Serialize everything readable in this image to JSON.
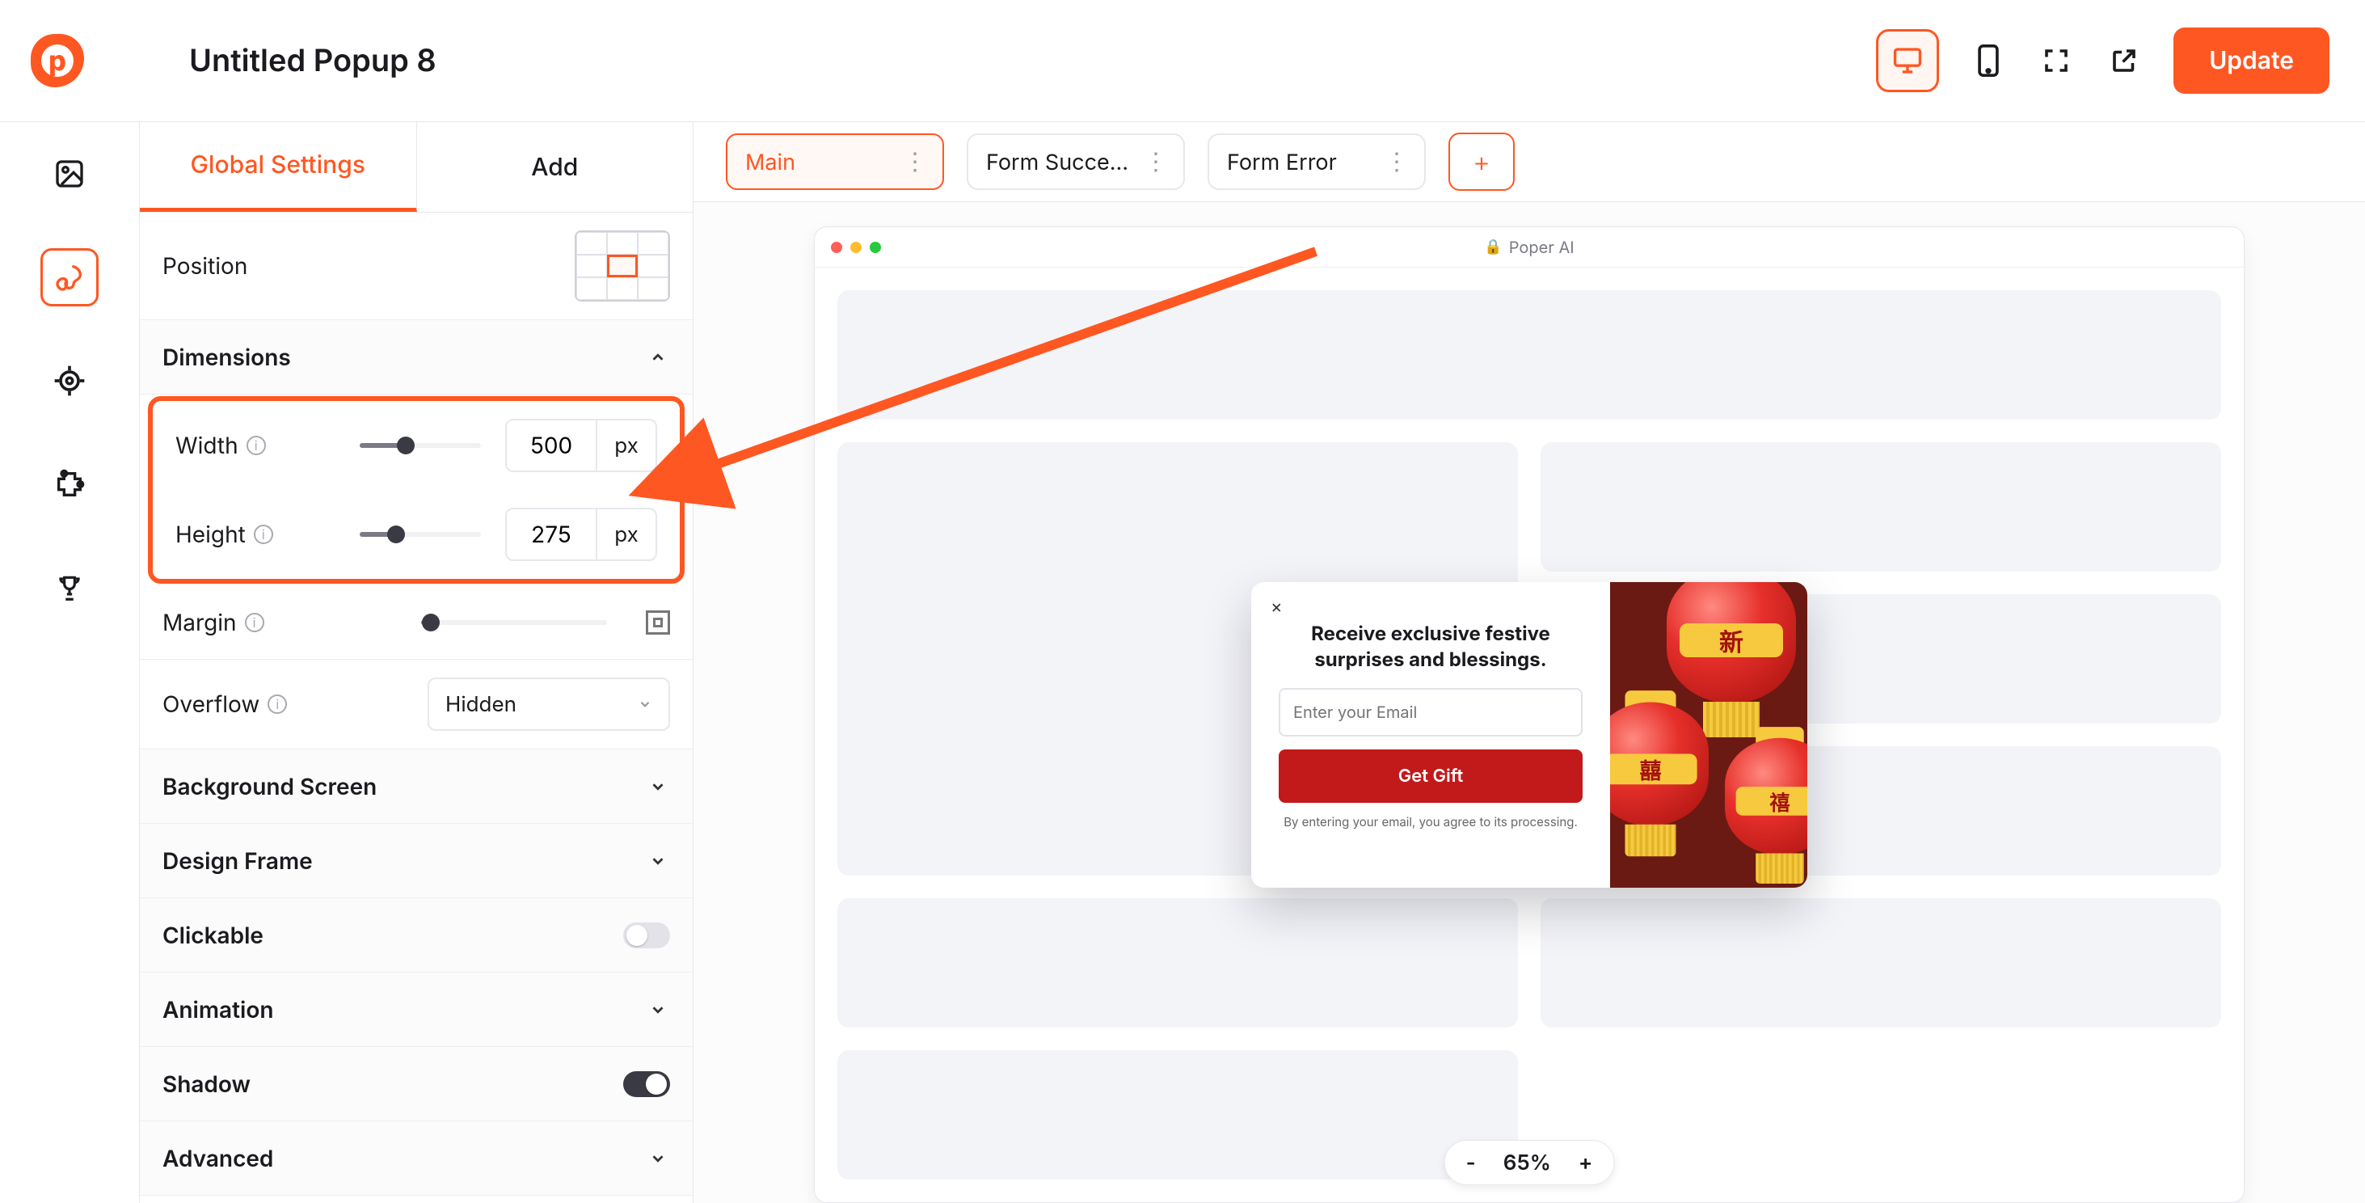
{
  "header": {
    "title": "Untitled Popup 8",
    "update_label": "Update"
  },
  "devices": {
    "active": "desktop"
  },
  "settings_tabs": {
    "global": "Global Settings",
    "add": "Add"
  },
  "panel": {
    "position_label": "Position",
    "dimensions_label": "Dimensions",
    "width_label": "Width",
    "width_value": "500",
    "width_unit": "px",
    "height_label": "Height",
    "height_value": "275",
    "height_unit": "px",
    "margin_label": "Margin",
    "overflow_label": "Overflow",
    "overflow_value": "Hidden",
    "background_label": "Background Screen",
    "design_frame_label": "Design Frame",
    "clickable_label": "Clickable",
    "animation_label": "Animation",
    "shadow_label": "Shadow",
    "advanced_label": "Advanced"
  },
  "states": {
    "main": "Main",
    "success": "Form Succe…",
    "error": "Form Error",
    "add": "+"
  },
  "browser": {
    "url_label": "Poper AI"
  },
  "popup": {
    "headline": "Receive exclusive festive surprises and blessings.",
    "email_placeholder": "Enter your Email",
    "cta_label": "Get Gift",
    "disclaimer": "By entering your email, you agree to its processing.",
    "close": "×"
  },
  "zoom": {
    "minus": "-",
    "value": "65%",
    "plus": "+"
  },
  "info_glyph": "i",
  "colors": {
    "brand": "#ff5722",
    "popup_cta": "#c2191a"
  }
}
